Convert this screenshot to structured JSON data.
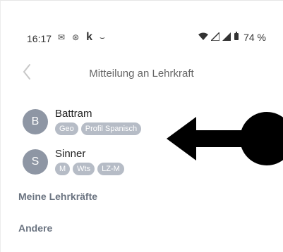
{
  "status_bar": {
    "time": "16:17",
    "left_icons": [
      "mail-icon",
      "settings-round-icon",
      "k-letter-icon",
      "smile-icon"
    ],
    "k_glyph": "k",
    "battery": "74 %"
  },
  "header": {
    "title": "Mitteilung an Lehrkraft"
  },
  "recipients": [
    {
      "initial": "B",
      "name": "Battram",
      "tags": [
        "Geo",
        "Profil Spanisch"
      ]
    },
    {
      "initial": "S",
      "name": "Sinner",
      "tags": [
        "M",
        "Wts",
        "LZ-M"
      ]
    }
  ],
  "sections": {
    "my_teachers": "Meine Lehrkräfte",
    "others": "Andere"
  },
  "colors": {
    "avatar": "#8e96a4",
    "tag": "#b6bcc6",
    "section_text": "#6a7380"
  }
}
